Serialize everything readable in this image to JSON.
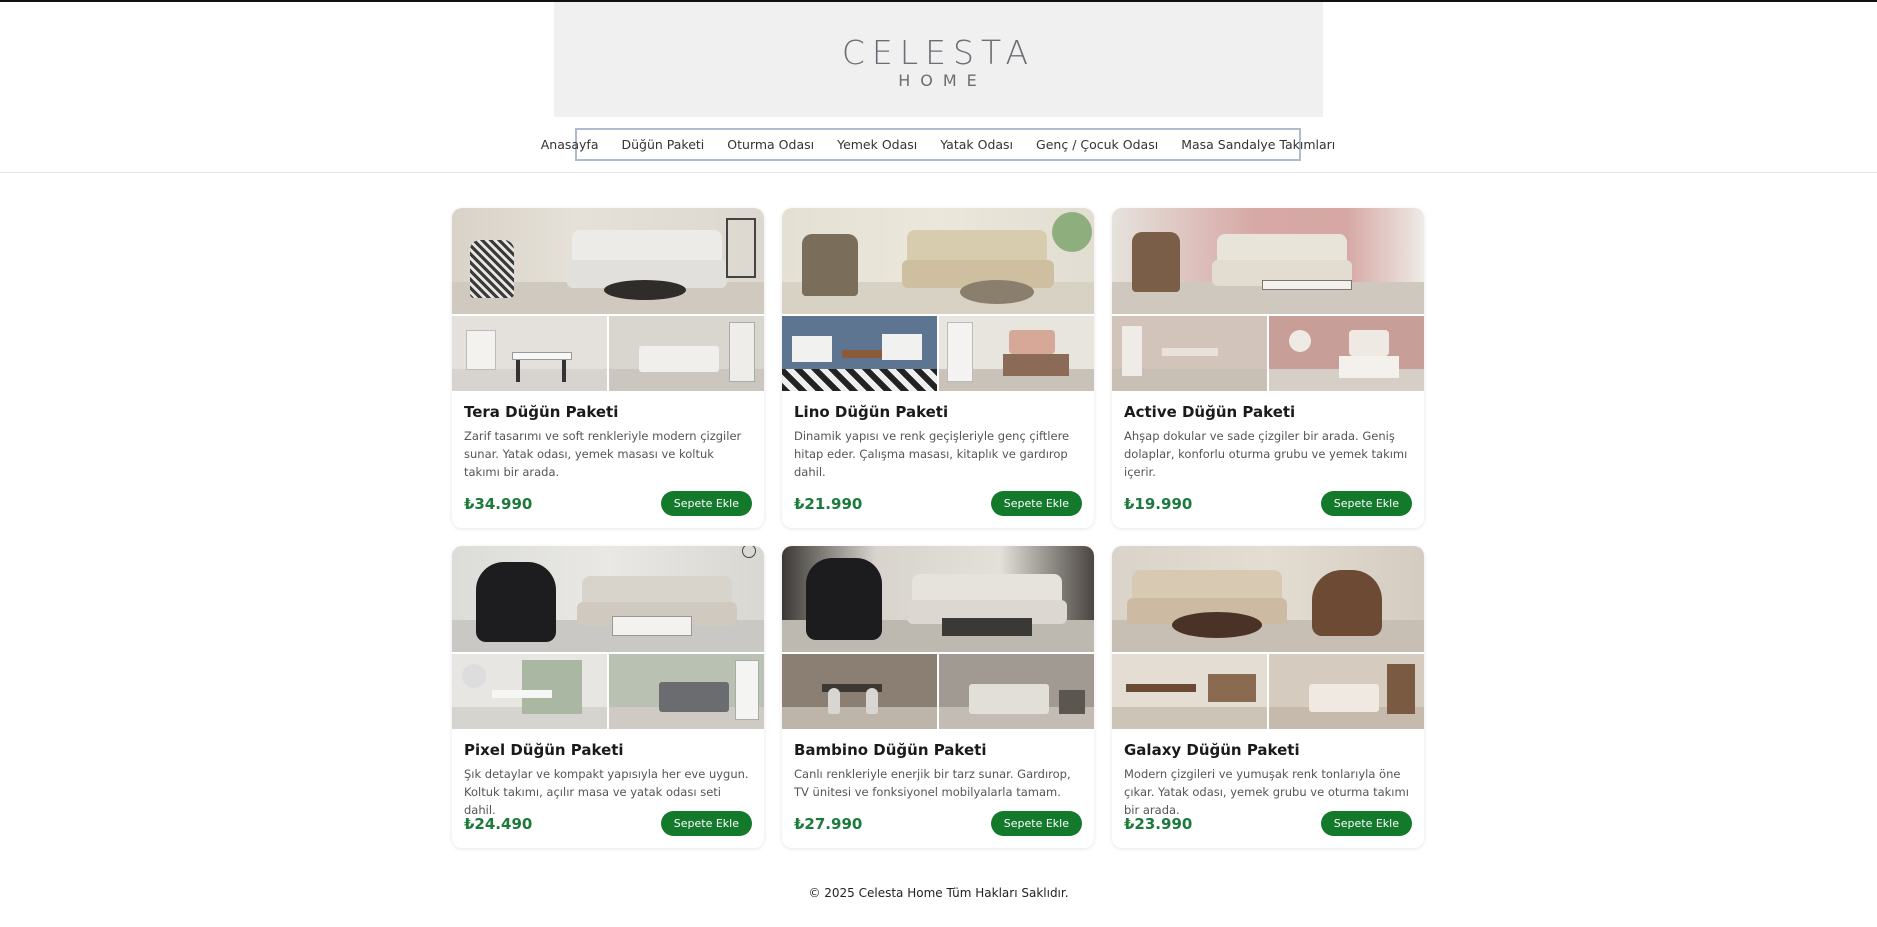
{
  "brand": {
    "logo_main": "CELESTA",
    "logo_sub": "HOME"
  },
  "nav": {
    "items": [
      "Anasayfa",
      "Düğün Paketi",
      "Oturma Odası",
      "Yemek Odası",
      "Yatak Odası",
      "Genç / Çocuk Odası",
      "Masa Sandalye Takımları"
    ]
  },
  "products": [
    {
      "title": "Tera Düğün Paketi",
      "description": "Zarif tasarımı ve soft renkleriyle modern çizgiler sunar. Yatak odası, yemek masası ve koltuk takımı bir arada.",
      "price": "₺34.990",
      "button": "Sepete Ekle"
    },
    {
      "title": "Lino Düğün Paketi",
      "description": "Dinamik yapısı ve renk geçişleriyle genç çiftlere hitap eder. Çalışma masası, kitaplık ve gardırop dahil.",
      "price": "₺21.990",
      "button": "Sepete Ekle"
    },
    {
      "title": "Active Düğün Paketi",
      "description": "Ahşap dokular ve sade çizgiler bir arada. Geniş dolaplar, konforlu oturma grubu ve yemek takımı içerir.",
      "price": "₺19.990",
      "button": "Sepete Ekle"
    },
    {
      "title": "Pixel Düğün Paketi",
      "description": "Şık detaylar ve kompakt yapısıyla her eve uygun. Koltuk takımı, açılır masa ve yatak odası seti dahil.",
      "price": "₺24.490",
      "button": "Sepete Ekle"
    },
    {
      "title": "Bambino Düğün Paketi",
      "description": "Canlı renkleriyle enerjik bir tarz sunar. Gardırop, TV ünitesi ve fonksiyonel mobilyalarla tamam.",
      "price": "₺27.990",
      "button": "Sepete Ekle"
    },
    {
      "title": "Galaxy Düğün Paketi",
      "description": "Modern çizgileri ve yumuşak renk tonlarıyla öne çıkar. Yatak odası, yemek grubu ve oturma takımı bir arada.",
      "price": "₺23.990",
      "button": "Sepete Ekle"
    }
  ],
  "footer": {
    "copyright": "© 2025 Celesta Home Tüm Hakları Saklıdır."
  },
  "colors": {
    "price": "#1c7a3a",
    "button": "#137a2b",
    "nav_border": "#aebccc",
    "banner_bg": "#f0f0f0"
  }
}
